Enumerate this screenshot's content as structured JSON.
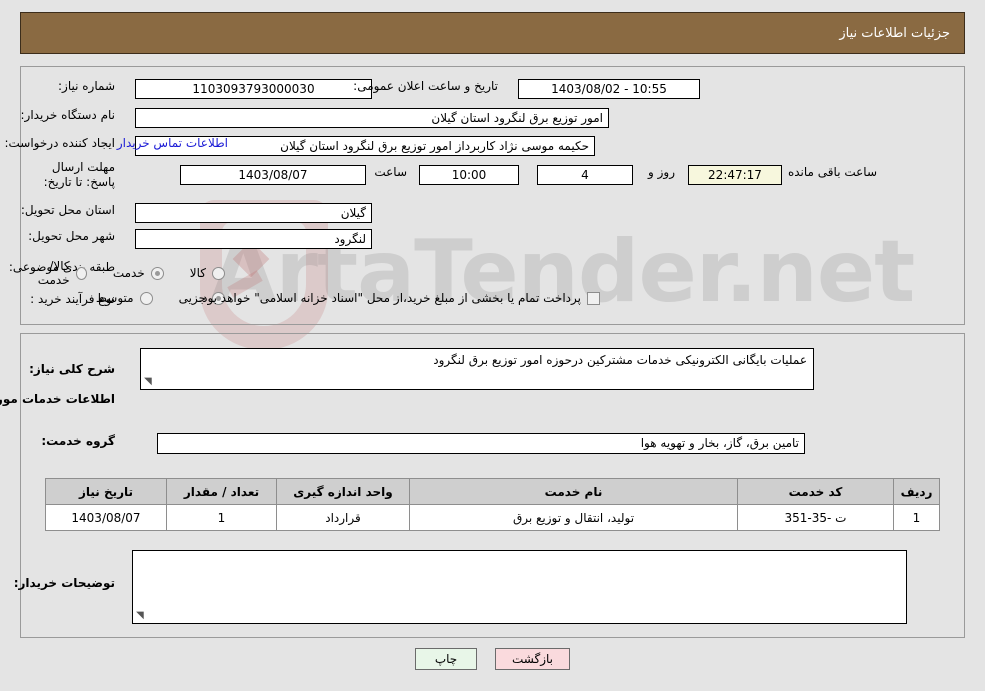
{
  "header": {
    "title": "جزئیات اطلاعات نیاز"
  },
  "watermark": {
    "text": "ArtaTender.net"
  },
  "top": {
    "need_number_label": "شماره نیاز:",
    "need_number_value": "1103093793000030",
    "announce_label": "تاریخ و ساعت اعلان عمومی:",
    "announce_value": "10:55 - 1403/08/02",
    "buyer_org_label": "نام دستگاه خریدار:",
    "buyer_org_value": "امور توزیع برق لنگرود استان گیلان",
    "creator_label": "ایجاد کننده درخواست:",
    "creator_value": "حکیمه موسی نژاد کاربرداز امور توزیع برق لنگرود استان گیلان",
    "contact_link": "اطلاعات تماس خریدار",
    "deadline_label": "مهلت ارسال پاسخ: تا تاریخ:",
    "deadline_date": "1403/08/07",
    "deadline_hour_label": "ساعت",
    "deadline_hour_value": "10:00",
    "days_value": "4",
    "days_unit_label": "روز و",
    "countdown_value": "22:47:17",
    "countdown_suffix_label": "ساعت باقی مانده",
    "province_label": "استان محل تحویل:",
    "province_value": "گیلان",
    "city_label": "شهر محل تحویل:",
    "city_value": "لنگرود",
    "category_label": "طبقه بندی موضوعی:",
    "category_options": [
      {
        "label": "کالا",
        "selected": false
      },
      {
        "label": "خدمت",
        "selected": true
      },
      {
        "label": "کالا/خدمت",
        "selected": false
      }
    ],
    "process_label": "نوع فرآیند خرید :",
    "process_options": [
      {
        "label": "جزیی",
        "selected": true
      },
      {
        "label": "متوسط",
        "selected": false
      }
    ],
    "treasury_checkbox_label": "پرداخت تمام یا بخشی از مبلغ خرید،از محل \"اسناد خزانه اسلامی\" خواهد بود.",
    "treasury_checked": false
  },
  "middle": {
    "summary_label": "شرح کلی نیاز:",
    "summary_value": "عملیات بایگانی الکترونیکی خدمات مشترکین  درحوزه امور توزیع برق لنگرود",
    "services_heading": "اطلاعات خدمات مورد نیاز",
    "service_group_label": "گروه خدمت:",
    "service_group_value": "تامین برق، گاز، بخار و تهویه هوا",
    "buyer_notes_label": "توضیحات خریدار:",
    "buyer_notes_value": ""
  },
  "table": {
    "columns": [
      "ردیف",
      "کد خدمت",
      "نام خدمت",
      "واحد اندازه گیری",
      "تعداد / مقدار",
      "تاریخ نیاز"
    ],
    "rows": [
      {
        "index": "1",
        "code": "ت -35-351",
        "name": "تولید، انتقال و توزیع برق",
        "unit": "قرارداد",
        "quantity": "1",
        "date": "1403/08/07"
      }
    ]
  },
  "buttons": {
    "back": "بازگشت",
    "print": "چاپ"
  },
  "colors": {
    "header_bg": "#8a6a42",
    "back_btn": "#fadadd",
    "print_btn": "#e8f6e8",
    "link": "#1a1ad6",
    "countdown_bg": "#f7f7dd"
  }
}
